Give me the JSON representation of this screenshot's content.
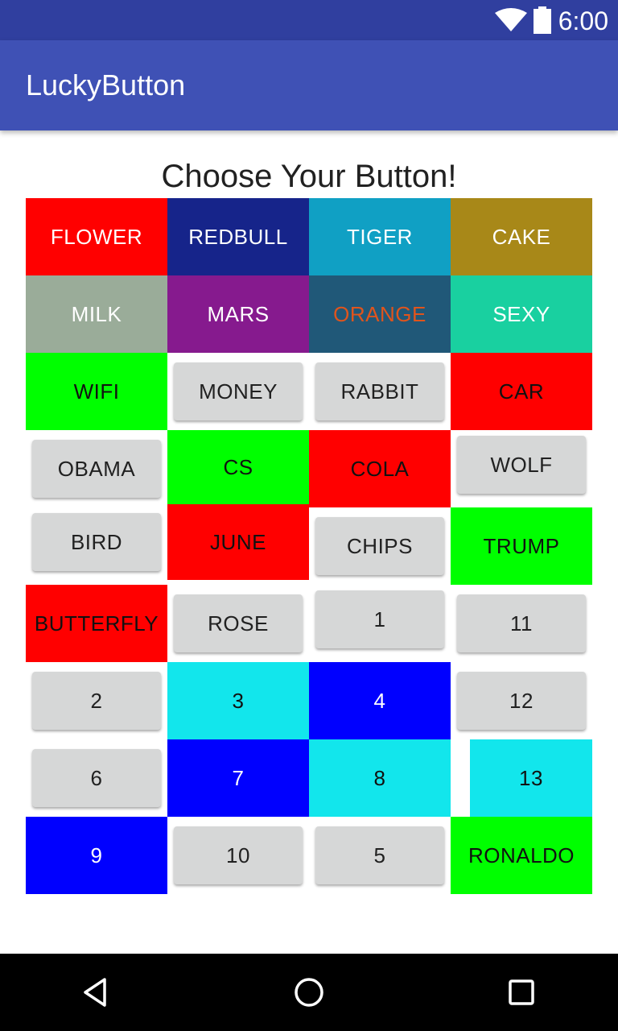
{
  "status_bar": {
    "time": "6:00",
    "wifi_icon": "wifi-icon",
    "battery_icon": "battery-icon"
  },
  "app_bar": {
    "title": "LuckyButton"
  },
  "heading": "Choose Your Button!",
  "colors": {
    "status_bar": "#303f9f",
    "app_bar": "#3f51b5",
    "red": "#ff0000",
    "green": "#00ff00",
    "blue": "#0000ff",
    "cyan": "#12e6ec",
    "navy": "#16248a",
    "teal": "#10a0c4",
    "olive": "#a88818",
    "sage": "#9aac99",
    "purple": "#861a8e",
    "slate": "#205878",
    "mint": "#19d0a0",
    "grey_button": "#d6d7d7"
  },
  "buttons": [
    {
      "label": "FLOWER",
      "bg": "#ff0000",
      "fg": "#ffffff"
    },
    {
      "label": "REDBULL",
      "bg": "#16248a",
      "fg": "#ffffff"
    },
    {
      "label": "TIGER",
      "bg": "#10a0c4",
      "fg": "#ffffff"
    },
    {
      "label": "CAKE",
      "bg": "#a88818",
      "fg": "#ffffff"
    },
    {
      "label": "MILK",
      "bg": "#9aac99",
      "fg": "#ffffff"
    },
    {
      "label": "MARS",
      "bg": "#861a8e",
      "fg": "#ffffff"
    },
    {
      "label": "ORANGE",
      "bg": "#205878",
      "fg": "#e0541c"
    },
    {
      "label": "SEXY",
      "bg": "#19d0a0",
      "fg": "#ffffff"
    },
    {
      "label": "WIFI",
      "bg": "#00ff00",
      "fg": "#111111"
    },
    {
      "label": "MONEY",
      "bg": "grey",
      "fg": "#212121"
    },
    {
      "label": "RABBIT",
      "bg": "grey",
      "fg": "#212121"
    },
    {
      "label": "CAR",
      "bg": "#ff0000",
      "fg": "#111111"
    },
    {
      "label": "OBAMA",
      "bg": "grey",
      "fg": "#212121"
    },
    {
      "label": "CS",
      "bg": "#00ff00",
      "fg": "#111111"
    },
    {
      "label": "COLA",
      "bg": "#ff0000",
      "fg": "#111111"
    },
    {
      "label": "WOLF",
      "bg": "grey",
      "fg": "#212121"
    },
    {
      "label": "BIRD",
      "bg": "grey",
      "fg": "#212121"
    },
    {
      "label": "JUNE",
      "bg": "#ff0000",
      "fg": "#111111"
    },
    {
      "label": "CHIPS",
      "bg": "grey",
      "fg": "#212121"
    },
    {
      "label": "TRUMP",
      "bg": "#00ff00",
      "fg": "#111111"
    },
    {
      "label": "BUTTERFLY",
      "bg": "#ff0000",
      "fg": "#111111"
    },
    {
      "label": "ROSE",
      "bg": "grey",
      "fg": "#212121"
    },
    {
      "label": "1",
      "bg": "grey",
      "fg": "#212121"
    },
    {
      "label": "11",
      "bg": "grey",
      "fg": "#212121"
    },
    {
      "label": "2",
      "bg": "grey",
      "fg": "#212121"
    },
    {
      "label": "3",
      "bg": "#12e6ec",
      "fg": "#111111"
    },
    {
      "label": "4",
      "bg": "#0000ff",
      "fg": "#ffffff"
    },
    {
      "label": "12",
      "bg": "grey",
      "fg": "#212121"
    },
    {
      "label": "6",
      "bg": "grey",
      "fg": "#212121"
    },
    {
      "label": "7",
      "bg": "#0000ff",
      "fg": "#ffffff"
    },
    {
      "label": "8",
      "bg": "#12e6ec",
      "fg": "#111111"
    },
    {
      "label": "13",
      "bg": "#12e6ec",
      "fg": "#111111"
    },
    {
      "label": "9",
      "bg": "#0000ff",
      "fg": "#ffffff"
    },
    {
      "label": "10",
      "bg": "grey",
      "fg": "#212121"
    },
    {
      "label": "5",
      "bg": "grey",
      "fg": "#212121"
    },
    {
      "label": "RONALDO",
      "bg": "#00ff00",
      "fg": "#111111"
    }
  ],
  "nav_bar": {
    "back_icon": "back-icon",
    "home_icon": "home-icon",
    "recents_icon": "recents-icon"
  }
}
